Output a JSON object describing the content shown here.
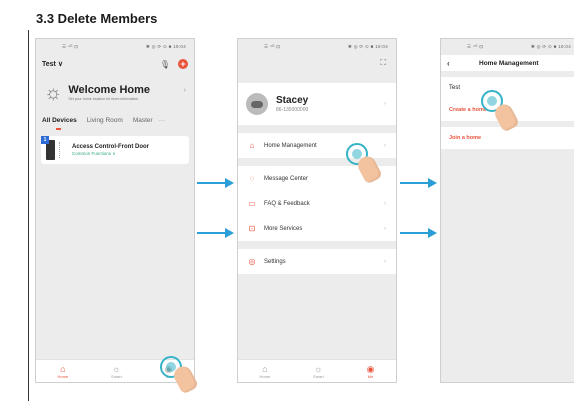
{
  "section_title": "3.3 Delete Members",
  "colors": {
    "accent": "#e8533c",
    "arrow": "#2b9ed8",
    "touch": "#36b3c7",
    "link_green": "#2ea87a",
    "badge_blue": "#2f6bd8"
  },
  "status_bar": {
    "left": "☰ ⁴ᴳ ⊡",
    "right": "✱ ◎ ⟳ ⊙ ■ 19:04"
  },
  "screen1": {
    "home_selector": "Test ∨",
    "welcome_title": "Welcome Home",
    "welcome_subtitle": "Set your home location for more information",
    "rooms": [
      "All Devices",
      "Living Room",
      "Master",
      "···"
    ],
    "device": {
      "badge": "1",
      "name": "Access Control-Front Door",
      "functions": "Common Functions ∨"
    },
    "nav": [
      {
        "label": "Home",
        "icon": "home-icon",
        "glyph": "⌂"
      },
      {
        "label": "Smart",
        "icon": "smart-icon",
        "glyph": "☼"
      },
      {
        "label": "Me",
        "icon": "me-icon",
        "glyph": "◉"
      }
    ]
  },
  "screen2": {
    "user_name": "Stacey",
    "user_phone": "86-135000000",
    "menu": [
      {
        "label": "Home Management",
        "icon": "house-outline-icon",
        "glyph": "⌂"
      },
      {
        "label": "Message Center",
        "icon": "message-icon",
        "glyph": "◌"
      },
      {
        "label": "FAQ & Feedback",
        "icon": "faq-icon",
        "glyph": "▭"
      },
      {
        "label": "More Services",
        "icon": "services-icon",
        "glyph": "⊡"
      },
      {
        "label": "Settings",
        "icon": "settings-icon",
        "glyph": "◎"
      }
    ],
    "nav": [
      {
        "label": "Home",
        "icon": "home-icon",
        "glyph": "⌂"
      },
      {
        "label": "Smart",
        "icon": "smart-icon",
        "glyph": "☼"
      },
      {
        "label": "Me",
        "icon": "me-icon",
        "glyph": "◉"
      }
    ]
  },
  "screen3": {
    "title": "Home Management",
    "home_name": "Test",
    "create_link": "Create a home",
    "join_link": "Join a home"
  }
}
